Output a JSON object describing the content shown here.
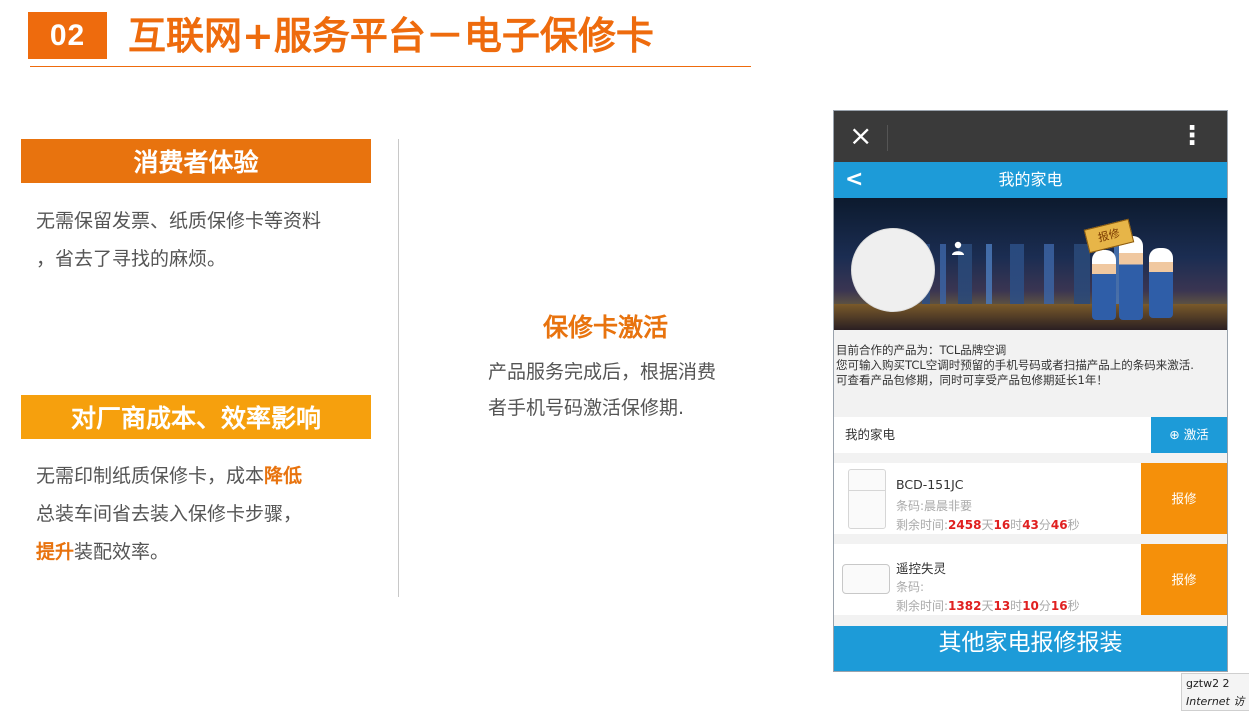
{
  "header": {
    "number": "02",
    "title": "互联网+服务平台－电子保修卡"
  },
  "consumer": {
    "title": "消费者体验",
    "line1": "无需保留发票、纸质保修卡等资料",
    "line2": "，省去了寻找的麻烦。"
  },
  "manufacturer": {
    "title": "对厂商成本、效率影响",
    "l1_prefix": "无需印制纸质保修卡，成本",
    "l1_highlight": "降低",
    "line2": "总装车间省去装入保修卡步骤，",
    "l3_highlight": "提升",
    "l3_suffix": "装配效率。"
  },
  "activation": {
    "title": "保修卡激活",
    "line1": "产品服务完成后，根据消费",
    "line2": "者手机号码激活保修期."
  },
  "phone": {
    "close_icon": "×",
    "menu_icon": "⋮",
    "back_icon": "<",
    "nav_title": "我的家电",
    "banner_sign": "报修",
    "info": [
      "目前合作的产品为：TCL品牌空调",
      "您可输入购买TCL空调时预留的手机号码或者扫描产品上的条码来激活.",
      "可查看产品包修期，同时可享受产品包修期延长1年！"
    ],
    "my_appliance_label": "我的家电",
    "activate_label": "⊕ 激活",
    "cards": [
      {
        "name": "BCD-151JC",
        "code": "条码:晨晨非要",
        "time_prefix": "剩余时间:",
        "days": "2458",
        "hours": "16",
        "minutes": "43",
        "seconds": "46",
        "button": "报修"
      },
      {
        "name": "遥控失灵",
        "code": "条码:",
        "time_prefix": "剩余时间:",
        "days": "1382",
        "hours": "13",
        "minutes": "10",
        "seconds": "16",
        "button": "报修"
      }
    ],
    "units": {
      "day": "天",
      "hour": "时",
      "minute": "分",
      "second": "秒"
    },
    "bottom_button": "其他家电报修报装"
  },
  "status": {
    "id": "gztw2  2",
    "zone": "Internet 访"
  },
  "colors": {
    "accent_orange": "#ee6b0d",
    "light_orange": "#f6a00d",
    "button_orange": "#f5900a",
    "phone_blue": "#1d9bd8",
    "countdown_red": "#e02020"
  }
}
